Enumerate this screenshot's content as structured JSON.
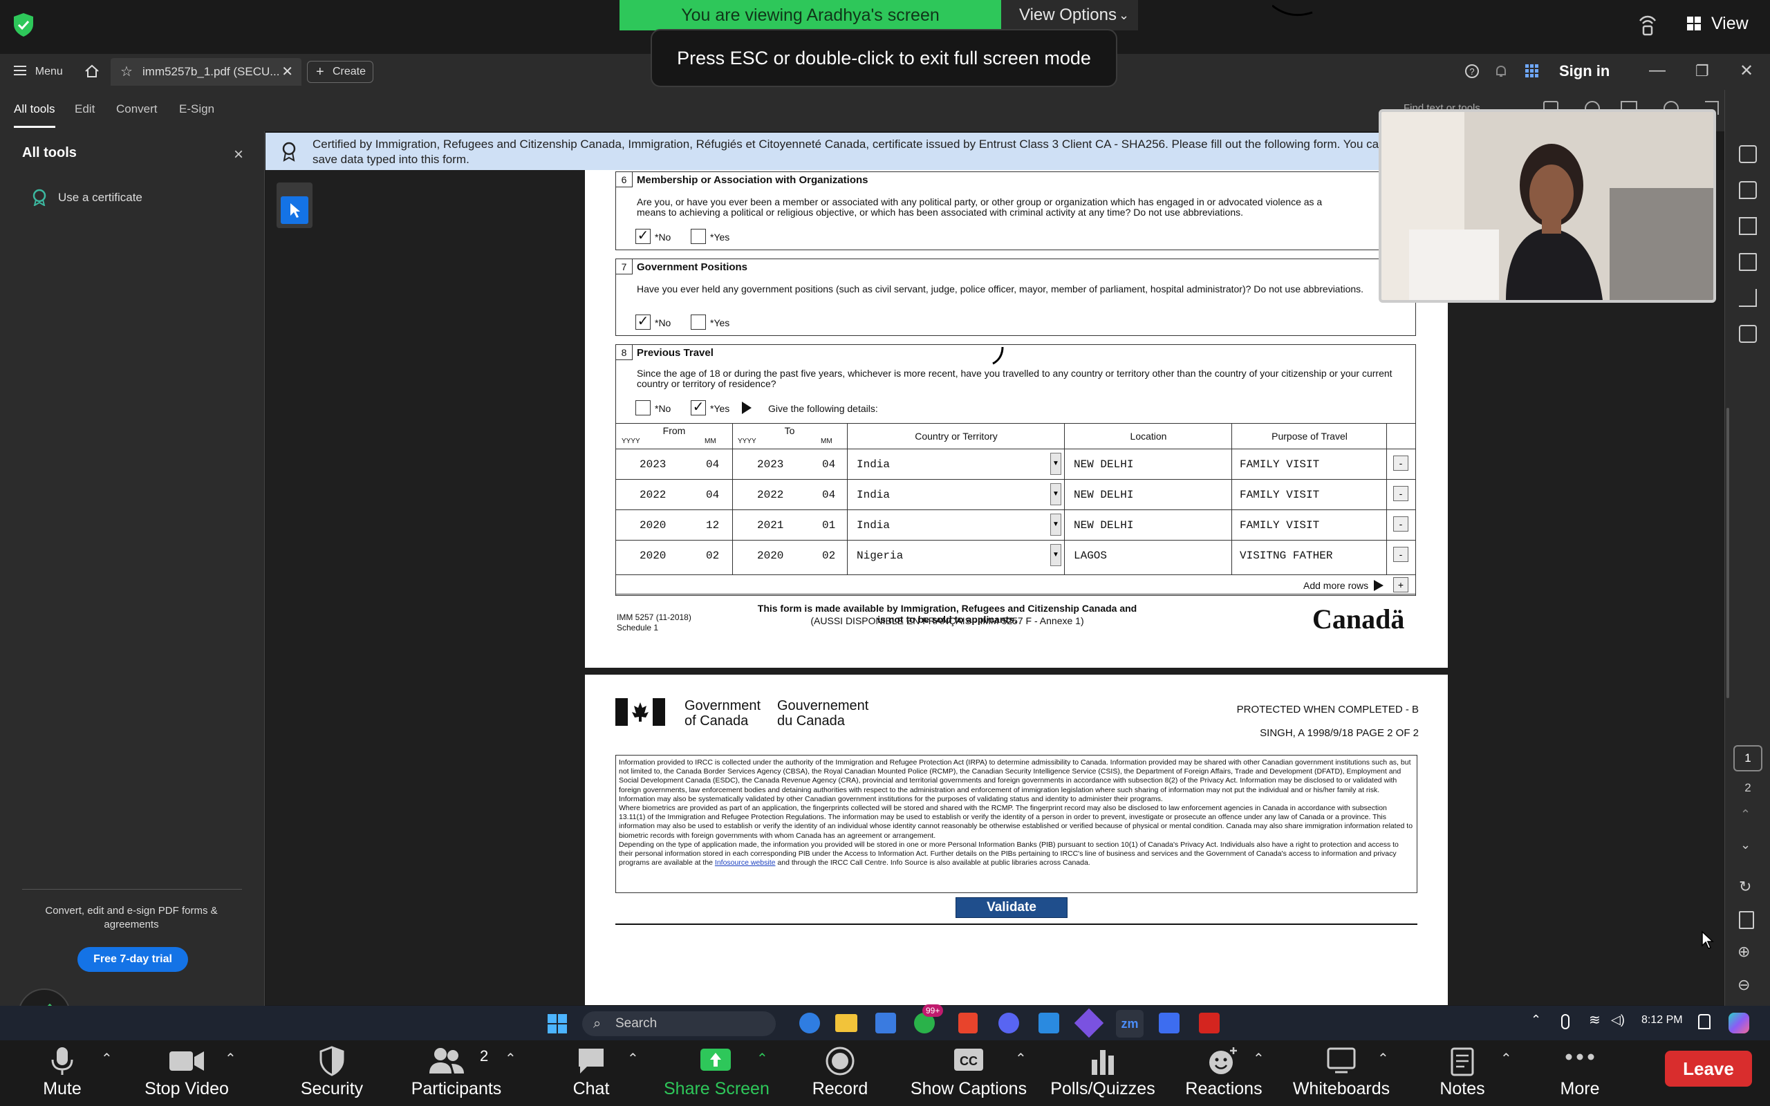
{
  "zoom_top": {
    "viewing_banner": "You are viewing Aradhya's screen",
    "view_options": "View Options",
    "esc_toast": "Press ESC or double-click to exit full screen mode",
    "view_label": "View"
  },
  "acrobat": {
    "menu_label": "Menu",
    "tab_file": "imm5257b_1.pdf (SECU...",
    "create_label": "Create",
    "sign_in": "Sign in",
    "find_placeholder": "Find text or tools",
    "toolbar_tabs": [
      "All tools",
      "Edit",
      "Convert",
      "E-Sign"
    ],
    "left_panel": {
      "title": "All tools",
      "use_certificate": "Use a certificate",
      "promo": "Convert, edit and e-sign PDF forms & agreements",
      "trial_button": "Free 7-day trial"
    },
    "cert_banner": "Certified by Immigration, Refugees and Citizenship Canada, Immigration, Réfugiés et Citoyenneté Canada, certificate issued by Entrust Class 3 Client CA - SHA256.  Please fill out the following form. You can save data typed into this form.",
    "page_numbers": [
      "1",
      "2"
    ]
  },
  "form": {
    "s6": {
      "num": "6",
      "title": "Membership or Association with Organizations",
      "question": "Are you, or have you ever been a member or associated with any political party, or other group or organization which has engaged in or advocated violence as a means to achieving a political or religious objective, or which has been associated with criminal activity at any time? Do not use abbreviations.",
      "no": "*No",
      "yes": "*Yes",
      "checked": "no"
    },
    "s7": {
      "num": "7",
      "title": "Government Positions",
      "question": "Have you ever held any government positions (such as civil servant, judge, police officer, mayor, member of parliament, hospital administrator)? Do not use abbreviations.",
      "no": "*No",
      "yes": "*Yes",
      "checked": "no"
    },
    "s8": {
      "num": "8",
      "title": "Previous Travel",
      "question": "Since the age of 18 or during the past five years, whichever is more recent, have you travelled to any country or territory other than the country of your citizenship or your current country or territory of residence?",
      "no": "*No",
      "yes": "*Yes",
      "give_details": "Give the following details:",
      "checked": "yes"
    },
    "travel_headers": {
      "from": "From",
      "to": "To",
      "yyyy": "YYYY",
      "mm": "MM",
      "country": "Country or Territory",
      "location": "Location",
      "purpose": "Purpose of Travel"
    },
    "travel_rows": [
      {
        "from_y": "2023",
        "from_m": "04",
        "to_y": "2023",
        "to_m": "04",
        "country": "India",
        "location": "NEW DELHI",
        "purpose": "FAMILY VISIT"
      },
      {
        "from_y": "2022",
        "from_m": "04",
        "to_y": "2022",
        "to_m": "04",
        "country": "India",
        "location": "NEW DELHI",
        "purpose": "FAMILY VISIT"
      },
      {
        "from_y": "2020",
        "from_m": "12",
        "to_y": "2021",
        "to_m": "01",
        "country": "India",
        "location": "NEW DELHI",
        "purpose": "FAMILY VISIT"
      },
      {
        "from_y": "2020",
        "from_m": "02",
        "to_y": "2020",
        "to_m": "02",
        "country": "Nigeria",
        "location": "LAGOS",
        "purpose": "VISITNG FATHER"
      }
    ],
    "add_more_rows": "Add more rows",
    "form_id": "IMM 5257 (11-2018)",
    "schedule": "Schedule 1",
    "availability": "This form is made available by Immigration, Refugees and Citizenship Canada and is not to be sold to applicants.",
    "availability_fr": "(AUSSI DISPONIBLE EN FRANÇAIS - IMM 5257 F - Annexe 1)",
    "canada_wordmark": "Canadä"
  },
  "page2": {
    "gov_en_1": "Government",
    "gov_en_2": "of Canada",
    "gov_fr_1": "Gouvernement",
    "gov_fr_2": "du Canada",
    "protected": "PROTECTED WHEN COMPLETED - B",
    "applicant_line": "SINGH, A 1998/9/18   PAGE 2 OF 2",
    "privacy_p1": "Information provided to IRCC is collected under the authority of the Immigration and Refugee Protection Act (IRPA) to determine admissibility to Canada. Information provided may be shared with other Canadian government institutions such as, but not limited to, the Canada Border Services Agency (CBSA), the Royal Canadian Mounted Police (RCMP), the Canadian Security Intelligence Service (CSIS), the Department of Foreign Affairs, Trade and Development (DFATD), Employment and Social Development Canada (ESDC), the Canada Revenue Agency (CRA), provincial and territorial governments and foreign governments in accordance with subsection 8(2) of the Privacy Act. Information may be disclosed to or validated with foreign governments, law enforcement bodies and detaining authorities with respect to the administration and enforcement of immigration legislation where such sharing of information may not put the individual and or his/her family at risk. Information may also be systematically validated by other Canadian government institutions for the purposes of validating status and identity to administer their programs.",
    "privacy_p2": "Where biometrics are provided as part of an application, the fingerprints collected will be stored and shared with the RCMP. The fingerprint record may also be disclosed to law enforcement agencies in Canada in accordance with subsection 13.11(1) of the Immigration and Refugee Protection Regulations. The information may be used to establish or verify the identity of a person in order to prevent, investigate or prosecute an offence under any law of Canada or a province. This information may also be used to establish or verify the identity of an individual whose identity cannot reasonably be otherwise established or verified because of physical or mental condition. Canada may also share immigration information related to biometric records with foreign governments with whom Canada has an agreement or arrangement.",
    "privacy_p3a": "Depending on the type of application made, the information you provided will be stored in one or more Personal Information Banks (PIB) pursuant to section 10(1) of Canada's Privacy Act. Individuals also have a right to protection and access to their personal information stored in each corresponding PIB under the Access to Information Act. Further details on the PIBs pertaining to IRCC's line of business and services and the Government of Canada's access to information and privacy programs are available at the ",
    "privacy_link": "Infosource website",
    "privacy_p3b": " and through the IRCC Call Centre. Info Source is also available at public libraries across Canada.",
    "validate": "Validate"
  },
  "taskbar": {
    "search": "Search",
    "badge": "99+",
    "time": "8:12 PM"
  },
  "zoom_bottom": {
    "participants_count": "2",
    "buttons": [
      "Mute",
      "Stop Video",
      "Security",
      "Participants",
      "Chat",
      "Share Screen",
      "Record",
      "Show Captions",
      "Polls/Quizzes",
      "Reactions",
      "Whiteboards",
      "Notes",
      "More"
    ],
    "leave": "Leave"
  },
  "colors": {
    "zoom_green": "#2ec75a",
    "leave_red": "#d92d2d",
    "acrobat_blue": "#1473e6",
    "validate_navy": "#1f4e8c"
  }
}
